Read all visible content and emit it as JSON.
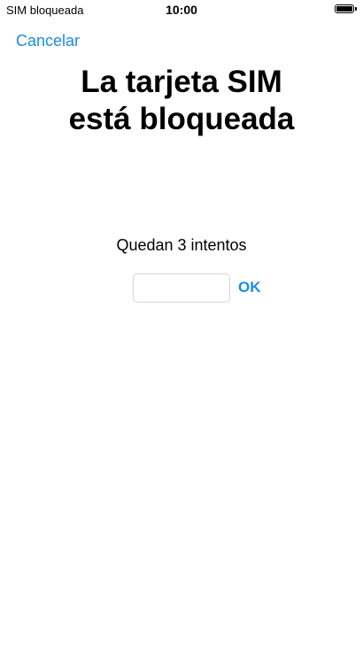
{
  "status_bar": {
    "carrier": "SIM bloqueada",
    "time": "10:00",
    "battery_icon": "battery-full-icon"
  },
  "nav": {
    "cancel_label": "Cancelar"
  },
  "main": {
    "title_line1": "La tarjeta SIM",
    "title_line2": "está bloqueada",
    "attempts_text": "Quedan 3 intentos",
    "pin_value": "",
    "ok_label": "OK"
  },
  "colors": {
    "accent": "#1a8ce0",
    "text": "#000000",
    "background": "#ffffff",
    "input_border": "#d6d6d6"
  }
}
